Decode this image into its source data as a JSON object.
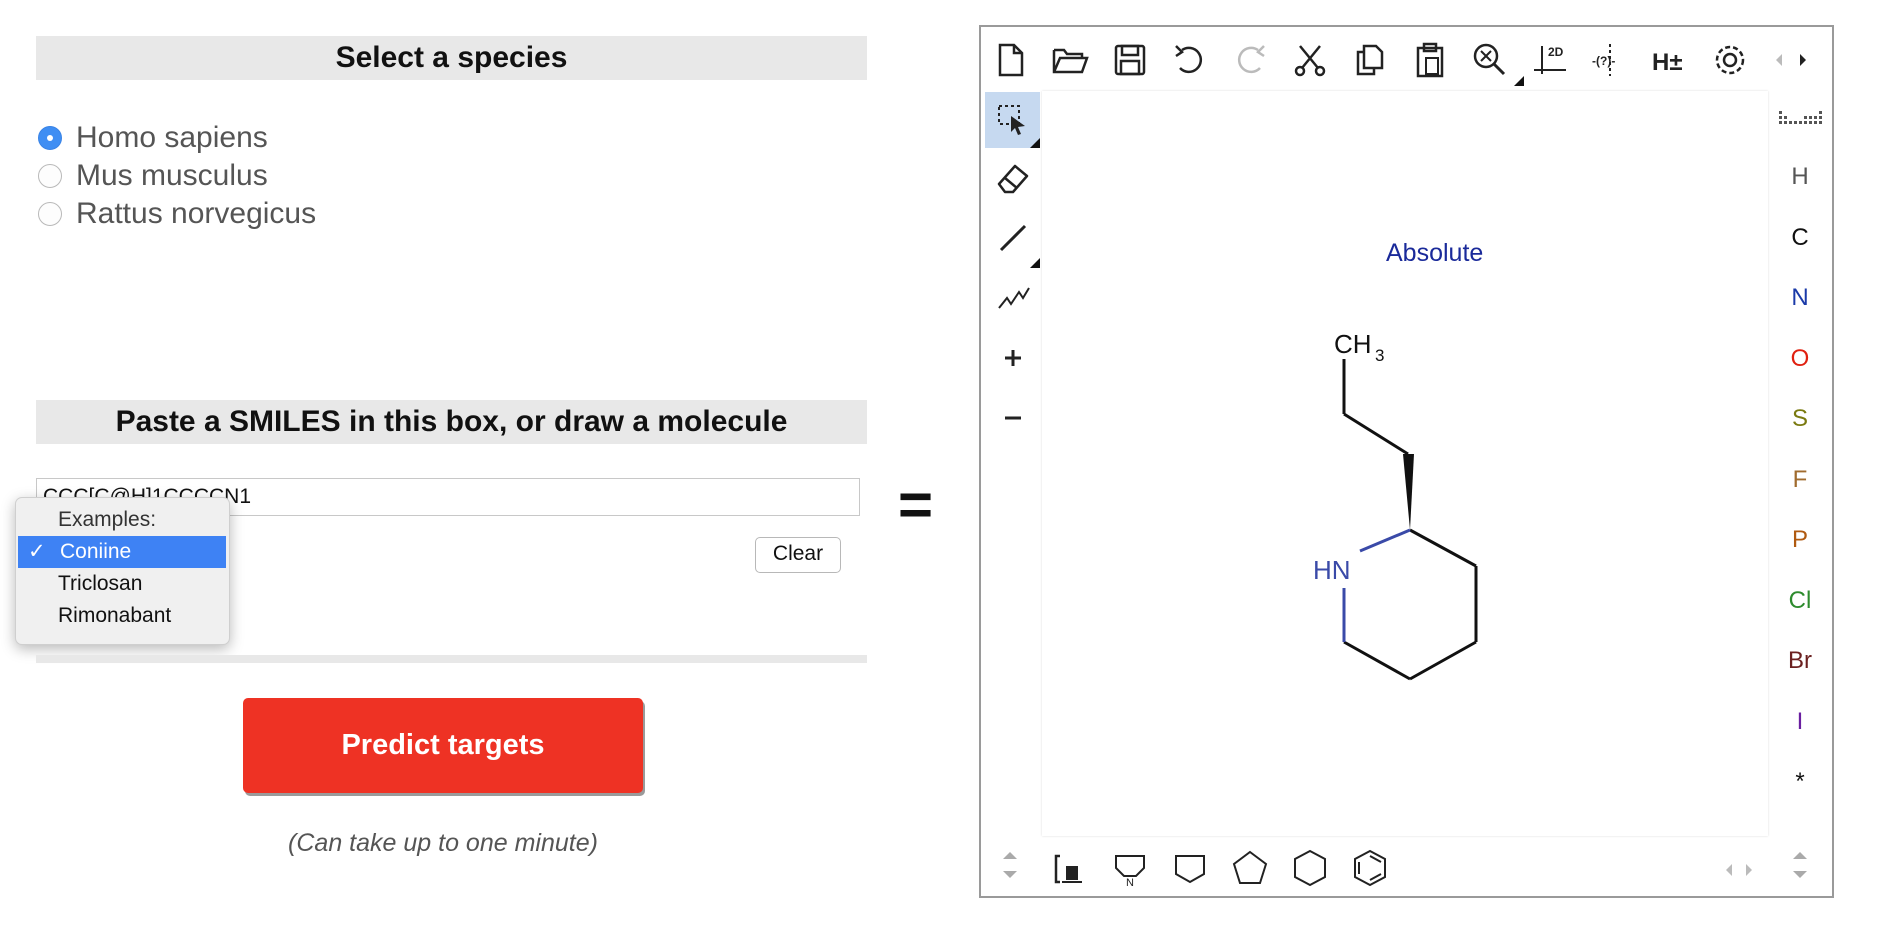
{
  "species": {
    "header": "Select a species",
    "options": [
      "Homo sapiens",
      "Mus musculus",
      "Rattus norvegicus"
    ],
    "selected": "Homo sapiens"
  },
  "smiles": {
    "header": "Paste a SMILES in this box, or draw a molecule",
    "value": "CCC[C@H]1CCCCN1",
    "clear_label": "Clear"
  },
  "examples": {
    "items": [
      "Examples:",
      "Coniine",
      "Triclosan",
      "Rimonabant"
    ],
    "selected": "Coniine",
    "check": "✓"
  },
  "predict": {
    "label": "Predict targets",
    "note": "(Can take up to one minute)"
  },
  "equals_sign": "=",
  "editor": {
    "canvas_label": "Absolute",
    "atom_ch3": "CH",
    "atom_ch3_sub": "3",
    "atom_hn": "HN",
    "toolbar_2d": "2D",
    "toolbar_query": "-(?)-",
    "toolbar_h": "H±",
    "elements": [
      {
        "symbol": "H",
        "color": "#555555"
      },
      {
        "symbol": "C",
        "color": "#111111"
      },
      {
        "symbol": "N",
        "color": "#1a3aa8"
      },
      {
        "symbol": "O",
        "color": "#e02010"
      },
      {
        "symbol": "S",
        "color": "#7a7a10"
      },
      {
        "symbol": "F",
        "color": "#a06b2e"
      },
      {
        "symbol": "P",
        "color": "#b05a10"
      },
      {
        "symbol": "Cl",
        "color": "#2e8b2e"
      },
      {
        "symbol": "Br",
        "color": "#6b2020"
      },
      {
        "symbol": "I",
        "color": "#6a1fa0"
      },
      {
        "symbol": "*",
        "color": "#111111"
      }
    ]
  },
  "colors": {
    "accent_button": "#ee3224",
    "radio_selected": "#3f8ef3",
    "dropdown_highlight": "#3e82f4",
    "canvas_label": "#1a2a9a"
  }
}
